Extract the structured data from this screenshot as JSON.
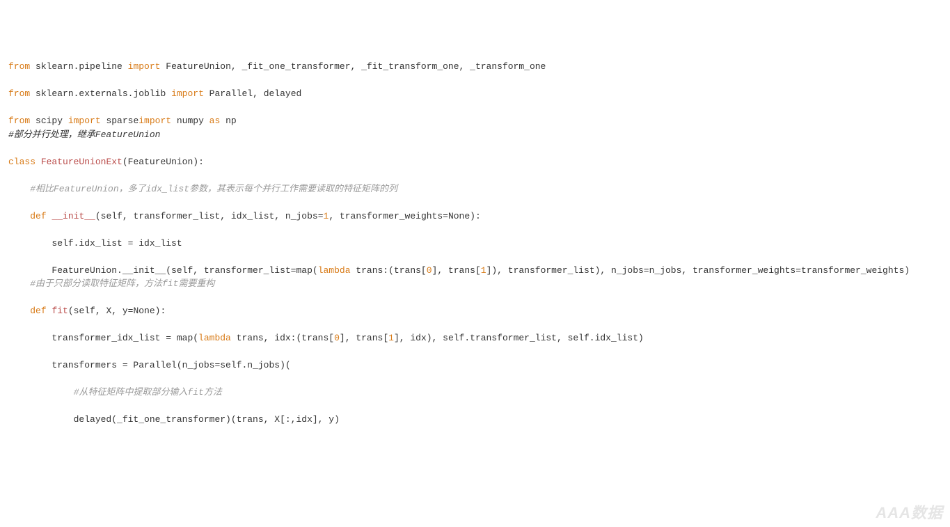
{
  "colors": {
    "keyword_orange": "#d87a16",
    "numeric_orange": "#d87a16",
    "classname_red": "#b94a48",
    "comment_gray": "#9a9a9a",
    "text_default": "#333333"
  },
  "watermark": "AAA数据",
  "code": {
    "l1": {
      "from": "from",
      "mod1": " sklearn.pipeline ",
      "import": "import",
      "rest": " FeatureUnion, _fit_one_transformer, _fit_transform_one, _transform_one"
    },
    "l2": {
      "from": "from",
      "mod1": " sklearn.externals.joblib ",
      "import": "import",
      "rest": " Parallel, delayed"
    },
    "l3": {
      "from1": "from",
      "mod1": " scipy ",
      "import1": "import",
      "mid": " sparse",
      "import2": "import",
      "mid2": " numpy ",
      "as": "as",
      "rest": " np"
    },
    "l4": {
      "comment": "#部分并行处理，继承FeatureUnion"
    },
    "l5": {
      "class": "class",
      "sp": " ",
      "name": "FeatureUnionExt",
      "rest": "(FeatureUnion):"
    },
    "l6": {
      "comment": "    #相比FeatureUnion，多了idx_list参数，其表示每个并行工作需要读取的特征矩阵的列"
    },
    "l7": {
      "indent": "    ",
      "def": "def",
      "sp": " ",
      "name": "__init__",
      "sig1": "(self, transformer_list, idx_list, n_jobs=",
      "one": "1",
      "sig2": ", transformer_weights=None):"
    },
    "l8": {
      "text": "        self.idx_list = idx_list"
    },
    "l9": {
      "pre": "        FeatureUnion.__init__(self, transformer_list=map(",
      "lambda": "lambda",
      "mid1": " trans:(trans[",
      "zero": "0",
      "mid2": "], trans[",
      "one": "1",
      "post": "]), transformer_list), n_jobs=n_jobs, transformer_weights=transformer_weights)"
    },
    "l10": {
      "comment": "    #由于只部分读取特征矩阵，方法fit需要重构"
    },
    "l11": {
      "indent": "    ",
      "def": "def",
      "sp": " ",
      "name": "fit",
      "sig": "(self, X, y=None):"
    },
    "l12": {
      "pre": "        transformer_idx_list = map(",
      "lambda": "lambda",
      "mid1": " trans, idx:(trans[",
      "zero": "0",
      "mid2": "], trans[",
      "one": "1",
      "post": "], idx), self.transformer_list, self.idx_list)"
    },
    "l13": {
      "text": "        transformers = Parallel(n_jobs=self.n_jobs)("
    },
    "l14": {
      "comment": "            #从特征矩阵中提取部分输入fit方法"
    },
    "l15": {
      "text": "            delayed(_fit_one_transformer)(trans, X[:,idx], y)"
    }
  }
}
